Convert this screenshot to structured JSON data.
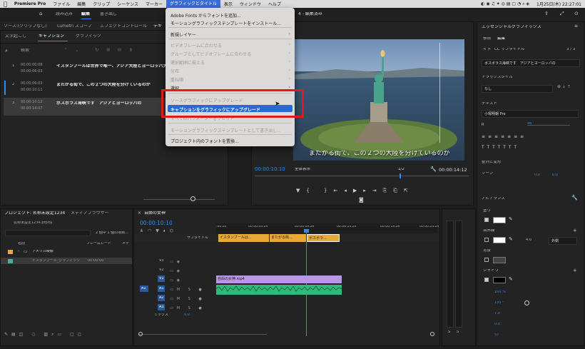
{
  "menubar": {
    "apple": "",
    "items": [
      "Premiere Pro",
      "ファイル",
      "編集",
      "クリップ",
      "シーケンス",
      "マーカー",
      "グラフィックとタイトル",
      "表示",
      "ウィンドウ",
      "ヘルプ"
    ],
    "clock": "1月25日(木) 22:27:01"
  },
  "workspace": {
    "tabs": [
      "読み込み",
      "編集",
      "書き出し"
    ],
    "project_title": "4 - 編集済み"
  },
  "source_bar": {
    "source": "ソース:(クリップなし)",
    "lumetri": "Lumetri スコープ",
    "effect": "エフェクトコントロール",
    "text": "テキ"
  },
  "text_panel": {
    "tabs": [
      "文字起こし",
      "キャプション",
      "グラフィック"
    ],
    "search_placeholder": "検索",
    "captions": [
      {
        "num": "1",
        "start": "00:00:00:08",
        "end": "00:00:06:03",
        "text": "イスタンブールは世界で唯一、アジア大陸とヨーロッパ大陸"
      },
      {
        "num": "2",
        "start": "00:00:06:03",
        "end": "00:00:10:11",
        "text": "またがる街で、この２つの大陸を分けているのが"
      },
      {
        "num": "3",
        "start": "00:00:10:12",
        "end": "00:00:14:07",
        "text": "ボスボラス海峡です　アジアとヨーロッパの"
      }
    ]
  },
  "dropdown": {
    "items": [
      {
        "label": "Adobe Fonts からフォントを追加...",
        "dis": false
      },
      {
        "label": "モーショングラフィックステンプレートをインストール...",
        "dis": false
      },
      {
        "label": "新規レイヤー",
        "dis": false,
        "sub": true
      },
      {
        "label": "ビデオフレームに合わせる",
        "dis": true,
        "sub": true
      },
      {
        "label": "グループとしてビデオフレームに合わせる",
        "dis": true,
        "sub": true
      },
      {
        "label": "選択範囲に揃える",
        "dis": true,
        "sub": true
      },
      {
        "label": "分布",
        "dis": true,
        "sub": true
      },
      {
        "label": "重ね順",
        "dis": true,
        "sub": true
      },
      {
        "label": "選択",
        "dis": false,
        "sub": true
      },
      {
        "label": "ソースグラフィックにアップグレード",
        "dis": true
      },
      {
        "label": "キャプションをグラフィックにアップグレード",
        "dis": false
      },
      {
        "label": "すべてのパラメーターをリセット",
        "dis": true
      },
      {
        "label": "モーショングラフィックステンプレートとして書き出し...",
        "dis": true
      },
      {
        "label": "プロジェクト内のフォントを置換...",
        "dis": false
      }
    ]
  },
  "program": {
    "subtitle": "またがる街で、この２つの大陸を分けているのが",
    "timecode": "00:00:10:10",
    "fit": "全体表示",
    "quality": "1/2",
    "duration": "00:00:14:12"
  },
  "project_panel": {
    "tab": "プロジェクト: 名称未設定1234",
    "media_tab": "メディアブラウザー",
    "file": "名称未設定1234.prproj",
    "count": "2 個中 1 個の項目...",
    "col_name": "名前",
    "col_fps": "フレームレート",
    "col_media": "メデ",
    "items": [
      {
        "name": "アメリカ映像"
      },
      {
        "name": "イスタンブール_グラフィック",
        "fps": "00:00:00"
      }
    ]
  },
  "timeline": {
    "tab": "自由の女神",
    "timecode": "00:00:10:10",
    "ruler": [
      ":00:00",
      "00:00:04:29",
      "00:00:09:29",
      "00:00:14:29",
      "00:00:19:29",
      "00:00:24:29"
    ],
    "caption_track": "サブタイトル",
    "caption_clips": [
      "イスタンブールは...",
      "またがる街...",
      "ボスボラ..."
    ],
    "tracks": [
      "V3",
      "V2",
      "V1",
      "A1",
      "A2",
      "A3"
    ],
    "video_clip": "自由の女神.mp4",
    "mix": "ミックス",
    "mix_val": "0.0"
  },
  "meter": {
    "labels": [
      "S",
      "S"
    ]
  },
  "essential": {
    "title": "エッセンシャルグラフィックス",
    "tabs": [
      "参照",
      "編集"
    ],
    "caption_item": "CC サブタイトル",
    "caption_count": "3 / 3",
    "caption_text": "ボスボラス海峡です　アジアとヨーロッパの",
    "track_style_lbl": "トラックスタイル",
    "track_style": "なし",
    "text_lbl": "テキスト",
    "font": "小塚明朝 Pro",
    "font_size": "48",
    "align_lbl": "整列と変形",
    "zone_lbl": "ゾーン",
    "pos_x": "0.0",
    "pos_y": "0.0",
    "appearance_lbl": "アピアランス",
    "fill_lbl": "塗り",
    "stroke_lbl": "境界線",
    "stroke_val": "4.0",
    "stroke_type": "外側",
    "bg_lbl": "背景",
    "shadow_lbl": "シャドウ",
    "opacity": "100 %",
    "angle": "135 °",
    "distance": "7.0",
    "size": "0.0",
    "blur": "57",
    "colors": {
      "fill": "#ffffff",
      "stroke": "#ffffff",
      "shadow": "#000000"
    }
  }
}
